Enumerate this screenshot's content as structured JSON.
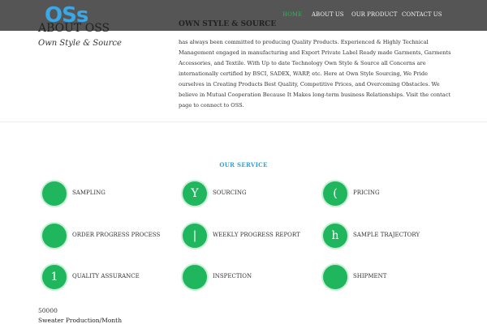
{
  "header": {
    "logo_text": "OSs",
    "nav": [
      {
        "label": "HOME",
        "active": true
      },
      {
        "label": "ABOUT US",
        "active": false
      },
      {
        "label": "OUR PRODUCT",
        "active": false
      },
      {
        "label": "CONTACT US",
        "active": false
      }
    ]
  },
  "about": {
    "title": "ABOUT OSS",
    "subtitle": "Own Style & Source",
    "heading": "OWN STYLE & SOURCE",
    "body": "has always been committed to producing Quality Products. Experienced & Highly Technical Management engaged in manufacturing and Export Private Label Ready made Garments, Garments Accessories, and Textile.  With Up to date Technology Own Style & Source all Concerns are internationally certified by BSCI, SADEX, WARP, etc. Here at Own Style Sourcing, We Pride ourselves in Creating Products Best Quality, Competitive Prices, and Overcoming Obstacles. We believe in Mutual Cooperation Because It Makes long-term business Relationships. Visit the contact page to connect to OSS."
  },
  "services": {
    "heading": "OUR SERVICE",
    "accent_color": "#1fb65d",
    "items": [
      {
        "label": "SAMPLING",
        "glyph": ""
      },
      {
        "label": "SOURCING",
        "glyph": "Y"
      },
      {
        "label": "PRICING",
        "glyph": "("
      },
      {
        "label": "ORDER PROGRESS PROCESS",
        "glyph": ""
      },
      {
        "label": "WEEKLY PROGRESS REPORT",
        "glyph": "|"
      },
      {
        "label": "SAMPLE TRAJECTORY",
        "glyph": "h"
      },
      {
        "label": "QUALITY ASSURANCE",
        "glyph": "1"
      },
      {
        "label": "INSPECTION",
        "glyph": ""
      },
      {
        "label": "SHIPMENT",
        "glyph": ""
      }
    ]
  },
  "stats": {
    "value": "50000",
    "label": "Sweater Production/Month"
  }
}
